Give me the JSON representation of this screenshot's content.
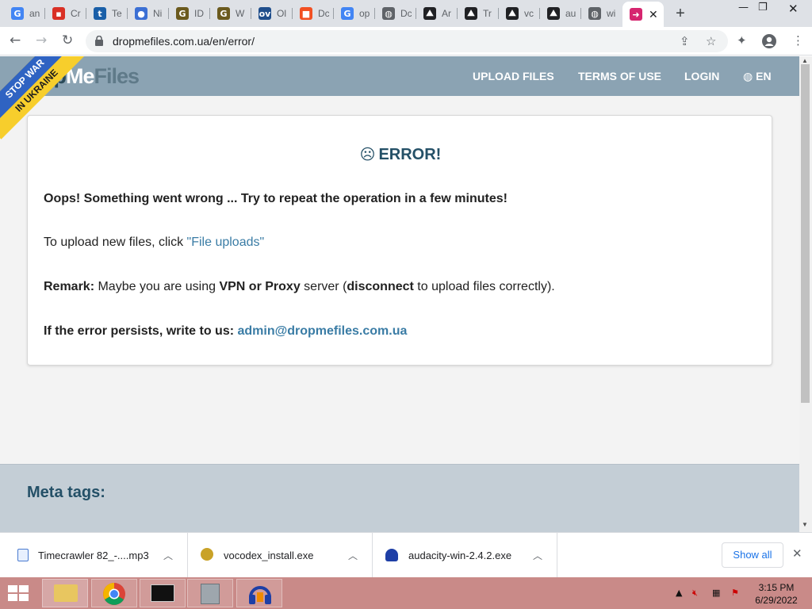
{
  "browser": {
    "tabs": [
      {
        "title": "an",
        "icon": "google-icon",
        "color": "#4285f4"
      },
      {
        "title": "Cr",
        "icon": "red-app-icon",
        "color": "#d93025"
      },
      {
        "title": "Te",
        "icon": "t-icon",
        "color": "#1a5fa8"
      },
      {
        "title": "Ni",
        "icon": "blue-shape-icon",
        "color": "#3b6fd4"
      },
      {
        "title": "ID",
        "icon": "g-gold-icon",
        "color": "#6b5a1e"
      },
      {
        "title": "W",
        "icon": "g-gold-icon",
        "color": "#6b5a1e"
      },
      {
        "title": "Ol",
        "icon": "ov-icon",
        "color": "#1f4e8c"
      },
      {
        "title": "Dc",
        "icon": "microsoft-icon",
        "color": "#f25022"
      },
      {
        "title": "op",
        "icon": "google-icon",
        "color": "#4285f4"
      },
      {
        "title": "Dc",
        "icon": "globe-icon",
        "color": "#5f6368"
      },
      {
        "title": "Ar",
        "icon": "mountain-icon",
        "color": "#202124"
      },
      {
        "title": "Tr",
        "icon": "mountain-icon",
        "color": "#202124"
      },
      {
        "title": "vc",
        "icon": "mountain-icon",
        "color": "#202124"
      },
      {
        "title": "au",
        "icon": "mountain-icon",
        "color": "#202124"
      },
      {
        "title": "wi",
        "icon": "globe-icon",
        "color": "#5f6368"
      }
    ],
    "active_tab_icon": "dropmefiles-icon",
    "active_tab_color": "#d6256f",
    "url": "dropmefiles.com.ua/en/error/"
  },
  "site": {
    "logo_a": "op",
    "logo_b": "Me",
    "logo_c": "Files",
    "banner_line1": "STOP WAR",
    "banner_line2": "IN UKRAINE",
    "nav": [
      "UPLOAD FILES",
      "TERMS OF USE",
      "LOGIN",
      "EN"
    ],
    "header_color": "#8ba3b3"
  },
  "error": {
    "face": "☹",
    "title": "ERROR!",
    "oops": "Oops! Something went wrong ... Try to repeat the operation in a few minutes!",
    "upload_pre": "To upload new files, click ",
    "upload_link": "\"File uploads\"",
    "remark_label": "Remark:",
    "remark_1": " Maybe you are using ",
    "remark_vpn": "VPN or Proxy",
    "remark_2": " server (",
    "remark_disc": "disconnect",
    "remark_3": " to upload files correctly).",
    "persist_label": "If the error persists, write to us: ",
    "email": "admin@dropmefiles.com.ua"
  },
  "meta": {
    "title": "Meta tags:"
  },
  "downloads": {
    "items": [
      {
        "name": "Timecrawler 82_-....mp3",
        "icon": "audio-file-icon"
      },
      {
        "name": "vocodex_install.exe",
        "icon": "installer-icon"
      },
      {
        "name": "audacity-win-2.4.2.exe",
        "icon": "audacity-icon"
      }
    ],
    "show_all": "Show all"
  },
  "taskbar": {
    "time": "3:15 PM",
    "date": "6/29/2022",
    "color": "#c98a88"
  }
}
